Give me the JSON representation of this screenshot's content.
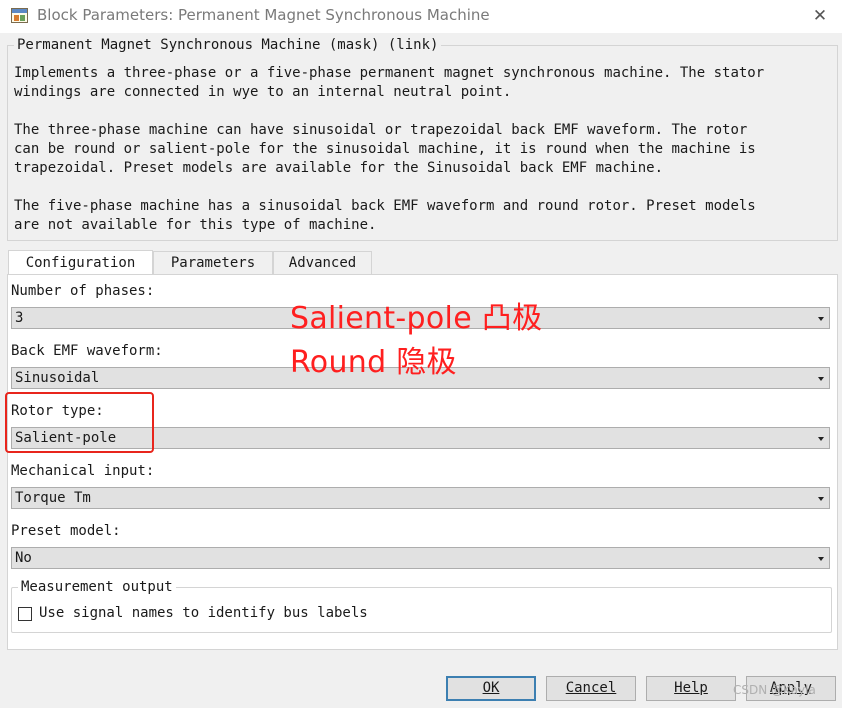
{
  "window": {
    "title": "Block Parameters: Permanent Magnet Synchronous Machine",
    "close_glyph": "✕",
    "icon": "simulink-block-icon"
  },
  "description": {
    "group_title": "Permanent Magnet Synchronous Machine (mask) (link)",
    "text": "Implements a three-phase or a five-phase permanent magnet synchronous machine. The stator\nwindings are connected in wye to an internal neutral point.\n\nThe three-phase machine can have sinusoidal or trapezoidal back EMF waveform. The rotor\ncan be round or salient-pole for the sinusoidal machine, it is round when the machine is\ntrapezoidal. Preset models are available for the Sinusoidal back EMF machine.\n\nThe five-phase machine has a sinusoidal back EMF waveform and round rotor. Preset models\nare not available for this type of machine."
  },
  "tabs": [
    {
      "label": "Configuration",
      "active": true
    },
    {
      "label": "Parameters",
      "active": false
    },
    {
      "label": "Advanced",
      "active": false
    }
  ],
  "fields": [
    {
      "label": "Number of phases:",
      "value": "3"
    },
    {
      "label": "Back EMF waveform:",
      "value": "Sinusoidal"
    },
    {
      "label": "Rotor type:",
      "value": "Salient-pole"
    },
    {
      "label": "Mechanical input:",
      "value": "Torque Tm"
    },
    {
      "label": "Preset model:",
      "value": "No"
    }
  ],
  "annotation": {
    "line1": "Salient-pole 凸极",
    "line2": "Round  隐极",
    "color": "#ff1f1f",
    "box_color": "#e8251c"
  },
  "measurement": {
    "group_title": "Measurement output",
    "checkbox_label": "Use signal names to identify bus labels",
    "checked": false
  },
  "buttons": {
    "ok": "OK",
    "cancel": "Cancel",
    "help": "Help",
    "apply": "Apply"
  },
  "watermark": "CSDN @Kayla",
  "colors": {
    "window_bg": "#f0f0f0",
    "panel_bg": "#ffffff",
    "button_bg": "#e1e1e1",
    "default_button_border": "#3c7fb1"
  }
}
